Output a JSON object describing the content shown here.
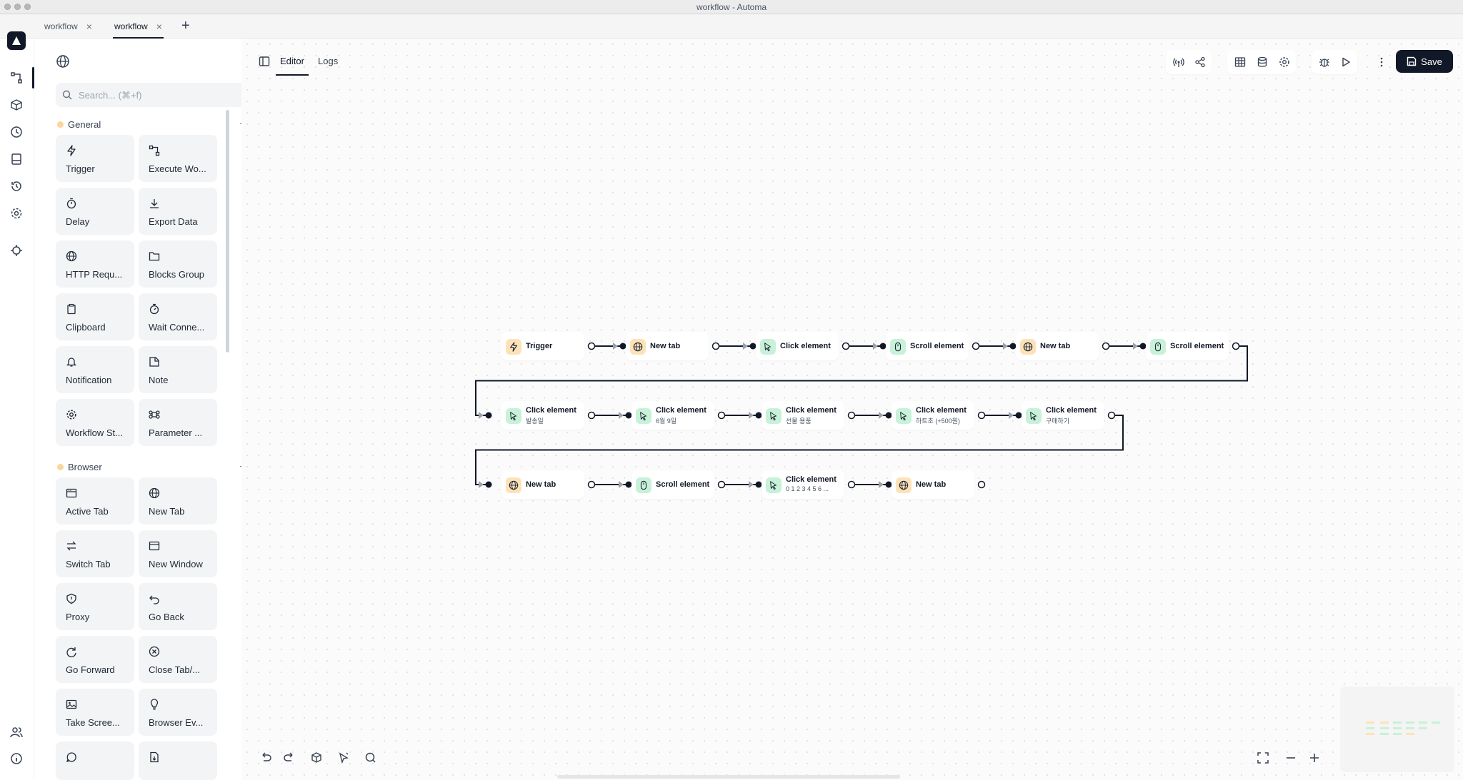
{
  "window": {
    "title": "workflow - Automa"
  },
  "tabs": [
    {
      "label": "workflow",
      "active": false
    },
    {
      "label": "workflow",
      "active": true
    }
  ],
  "sidebar": {
    "search_placeholder": "Search... (⌘+f)",
    "categories": [
      {
        "name": "General",
        "blocks": [
          {
            "label": "Trigger",
            "icon": "lightning-icon"
          },
          {
            "label": "Execute Wo...",
            "icon": "workflow-icon"
          },
          {
            "label": "Delay",
            "icon": "timer-icon"
          },
          {
            "label": "Export Data",
            "icon": "download-icon"
          },
          {
            "label": "HTTP Requ...",
            "icon": "globe-icon"
          },
          {
            "label": "Blocks Group",
            "icon": "folder-icon"
          },
          {
            "label": "Clipboard",
            "icon": "clipboard-icon"
          },
          {
            "label": "Wait Conne...",
            "icon": "stopwatch-icon"
          },
          {
            "label": "Notification",
            "icon": "bell-icon"
          },
          {
            "label": "Note",
            "icon": "note-icon"
          },
          {
            "label": "Workflow St...",
            "icon": "gear-icon"
          },
          {
            "label": "Parameter ...",
            "icon": "command-icon"
          }
        ]
      },
      {
        "name": "Browser",
        "blocks": [
          {
            "label": "Active Tab",
            "icon": "window-icon"
          },
          {
            "label": "New Tab",
            "icon": "globe-icon"
          },
          {
            "label": "Switch Tab",
            "icon": "switch-icon"
          },
          {
            "label": "New Window",
            "icon": "new-window-icon"
          },
          {
            "label": "Proxy",
            "icon": "shield-icon"
          },
          {
            "label": "Go Back",
            "icon": "back-arrow-icon"
          },
          {
            "label": "Go Forward",
            "icon": "forward-arrow-icon"
          },
          {
            "label": "Close Tab/...",
            "icon": "close-circle-icon"
          },
          {
            "label": "Take Scree...",
            "icon": "image-icon"
          },
          {
            "label": "Browser Ev...",
            "icon": "bulb-icon"
          }
        ]
      }
    ]
  },
  "editor": {
    "tabs": [
      {
        "label": "Editor",
        "active": true
      },
      {
        "label": "Logs",
        "active": false
      }
    ],
    "save_label": "Save"
  },
  "workflow": {
    "rows": [
      [
        {
          "title": "Trigger",
          "subtitle": "",
          "color": "amber",
          "icon": "lightning-icon"
        },
        {
          "title": "New tab",
          "subtitle": "",
          "color": "amber",
          "icon": "globe-icon"
        },
        {
          "title": "Click element",
          "subtitle": "",
          "color": "green",
          "icon": "cursor-icon"
        },
        {
          "title": "Scroll element",
          "subtitle": "",
          "color": "green",
          "icon": "mouse-icon"
        },
        {
          "title": "New tab",
          "subtitle": "",
          "color": "amber",
          "icon": "globe-icon"
        },
        {
          "title": "Scroll element",
          "subtitle": "",
          "color": "green",
          "icon": "mouse-icon"
        }
      ],
      [
        {
          "title": "Click element",
          "subtitle": "발송일",
          "color": "green",
          "icon": "cursor-icon"
        },
        {
          "title": "Click element",
          "subtitle": "6월 9일",
          "color": "green",
          "icon": "cursor-icon"
        },
        {
          "title": "Click element",
          "subtitle": "선물 용품",
          "color": "green",
          "icon": "cursor-icon"
        },
        {
          "title": "Click element",
          "subtitle": "하트초 (+500원)",
          "color": "green",
          "icon": "cursor-icon"
        },
        {
          "title": "Click element",
          "subtitle": "구매하기",
          "color": "green",
          "icon": "cursor-icon"
        }
      ],
      [
        {
          "title": "New tab",
          "subtitle": "",
          "color": "amber",
          "icon": "globe-icon"
        },
        {
          "title": "Scroll element",
          "subtitle": "",
          "color": "green",
          "icon": "mouse-icon"
        },
        {
          "title": "Click element",
          "subtitle": "0 1 2 3 4 5 6 ...",
          "color": "green",
          "icon": "cursor-icon"
        },
        {
          "title": "New tab",
          "subtitle": "",
          "color": "amber",
          "icon": "globe-icon"
        }
      ]
    ]
  },
  "colors": {
    "accent": "#111827",
    "amber": "#fde2b8",
    "green": "#c7f1d8",
    "category_dot": "#fcd59b"
  }
}
